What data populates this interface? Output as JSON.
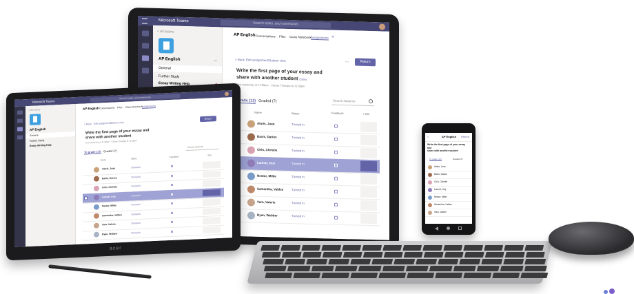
{
  "app_title": "Microsoft Teams",
  "search_placeholder": "Search tasks, and commands",
  "team_back": "< All teams",
  "team_name": "AP English",
  "channels": [
    "General",
    "Further Study",
    "Essay Writing Help"
  ],
  "tabs": [
    "Conversations",
    "Files",
    "Class Notebook",
    "Assignments"
  ],
  "tab_add": "+",
  "back_label": "< Back",
  "edit_assignment": "Edit assignment",
  "student_view": "Student view",
  "more_label": "...",
  "return_label": "Return",
  "assignment_title_line1": "Write the first page of your essay and",
  "assignment_title_line2": "share with another student",
  "assignment_title_flag": "Essay",
  "assignment_due": "Due yesterday at 11:59pm",
  "assignment_closes": "Closes Tuesday at 11:59pm",
  "to_grade_label": "To grade (13)",
  "graded_label": "Graded (7)",
  "search_students": "Search students",
  "col_name": "Name",
  "col_status": "Status",
  "col_feedback": "Feedback",
  "col_points": "/ 100",
  "students": [
    {
      "name": "Alaris, Juan",
      "status": "Turned in",
      "color": "#c8a27a"
    },
    {
      "name": "Baxis, Darius",
      "status": "Turned in",
      "color": "#9c6b4e"
    },
    {
      "name": "Chin, Christie",
      "status": "Turned in",
      "color": "#d9a3b4"
    },
    {
      "name": "Lamott, Guy",
      "status": "Turned in",
      "color": "#8f7bb8"
    },
    {
      "name": "Nestor, Millie",
      "status": "Turned in",
      "color": "#7a9cc8"
    },
    {
      "name": "Samantha, Valdes",
      "status": "Turned in",
      "color": "#bf8a6b"
    },
    {
      "name": "Vara, Valerie",
      "status": "Turned in",
      "color": "#c7a58c"
    },
    {
      "name": "Ryan, Webber",
      "status": "Turned in",
      "color": "#a8b4c4"
    }
  ],
  "phone_back": "<",
  "phone_team": "AP English",
  "phone_action": "Return",
  "phone_students": [
    "Alaris, Juan",
    "Baxis, Darius",
    "Chin, Christie",
    "Lamott, Guy",
    "Nestor, Millie",
    "Samantha, Valdes",
    "Vara, Valerie"
  ],
  "laptop_brand": "acer",
  "colors": {
    "accent": "#6264a7",
    "titlebar": "#464775",
    "rail": "#33344a",
    "selected_row": "#9ea2d4"
  }
}
